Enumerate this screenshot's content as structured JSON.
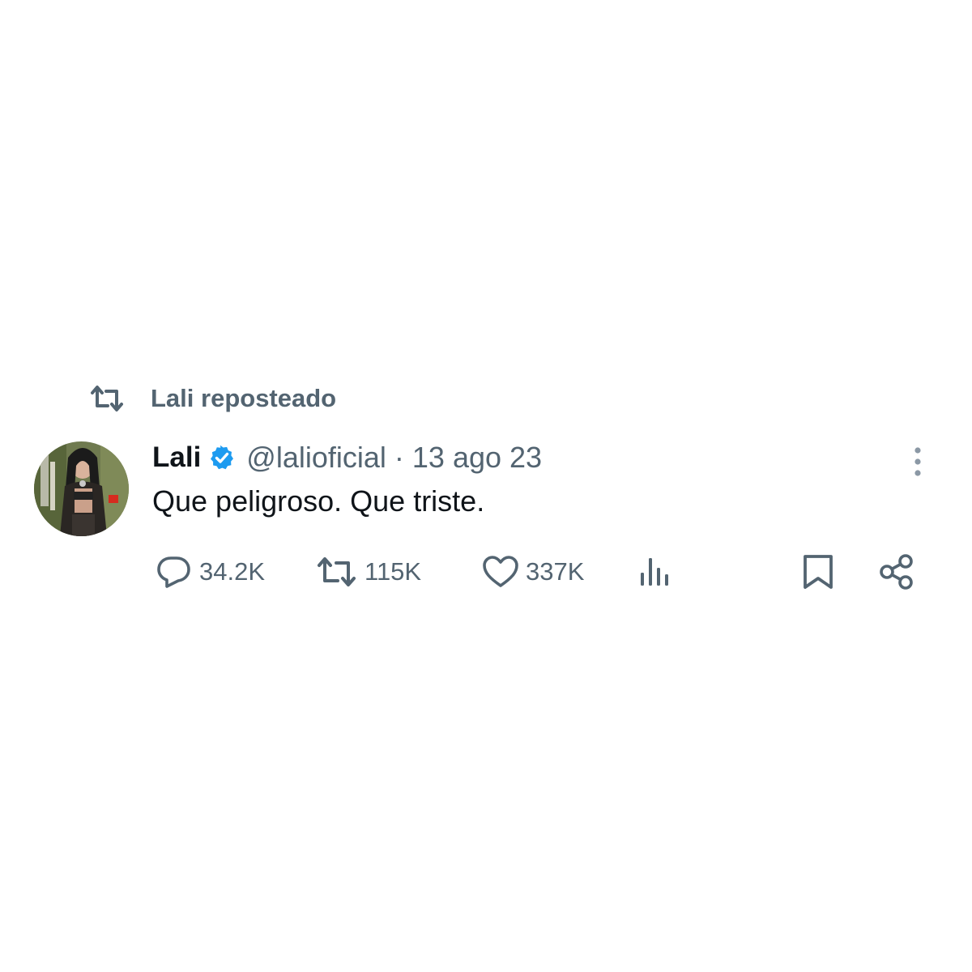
{
  "repost_banner": {
    "icon": "repost-icon",
    "label": "Lali reposteado"
  },
  "tweet": {
    "avatar": "profile-photo",
    "display_name": "Lali",
    "verified_icon": "verified-badge-icon",
    "handle": "@lalioficial",
    "separator": "·",
    "date": "13 ago 23",
    "text": "Que peligroso. Que triste.",
    "more_icon": "more-vertical-icon"
  },
  "actions": {
    "reply": {
      "icon": "reply-icon",
      "count": "34.2K"
    },
    "repost": {
      "icon": "repost-icon",
      "count": "115K"
    },
    "like": {
      "icon": "heart-icon",
      "count": "337K"
    },
    "views": {
      "icon": "views-icon"
    },
    "bookmark": {
      "icon": "bookmark-icon"
    },
    "share": {
      "icon": "share-icon"
    }
  },
  "colors": {
    "text": "#0f1419",
    "secondary": "#536471",
    "verified": "#1d9bf0",
    "background": "#ffffff"
  }
}
